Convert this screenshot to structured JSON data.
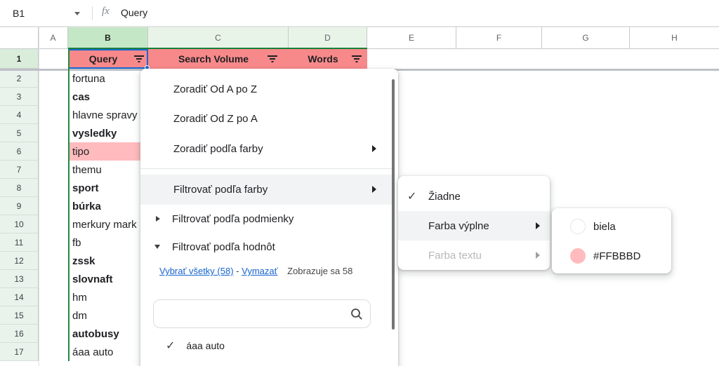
{
  "formula_bar": {
    "cell_ref": "B1",
    "fx_label": "fx",
    "value": "Query"
  },
  "sheet": {
    "col_letters": [
      "A",
      "B",
      "C",
      "D",
      "E",
      "F",
      "G",
      "H"
    ],
    "selected_column": "B",
    "header_cells": [
      {
        "col": "B",
        "label": "Query"
      },
      {
        "col": "C",
        "label": "Search Volume"
      },
      {
        "col": "D",
        "label": "Words"
      }
    ],
    "row1_number": "1",
    "rows": [
      {
        "n": "2",
        "text": "fortuna"
      },
      {
        "n": "3",
        "text": "cas"
      },
      {
        "n": "4",
        "text": "hlavne spravy"
      },
      {
        "n": "5",
        "text": "vysledky"
      },
      {
        "n": "6",
        "text": "tipo"
      },
      {
        "n": "7",
        "text": "themu"
      },
      {
        "n": "8",
        "text": "sport"
      },
      {
        "n": "9",
        "text": "búrka"
      },
      {
        "n": "10",
        "text": "merkury mark"
      },
      {
        "n": "11",
        "text": "fb"
      },
      {
        "n": "12",
        "text": "zssk"
      },
      {
        "n": "13",
        "text": "slovnaft"
      },
      {
        "n": "14",
        "text": "hm"
      },
      {
        "n": "15",
        "text": "dm"
      },
      {
        "n": "16",
        "text": "autobusy"
      },
      {
        "n": "17",
        "text": "áaa auto"
      }
    ]
  },
  "filter_menu": {
    "sort_az": "Zoradiť Od A po Z",
    "sort_za": "Zoradiť Od Z po A",
    "sort_color": "Zoradiť podľa farby",
    "filter_color": "Filtrovať podľa farby",
    "filter_condition": "Filtrovať podľa podmienky",
    "filter_values": "Filtrovať podľa hodnôt",
    "select_all": "Vybrať všetky (58)",
    "dash": "-",
    "clear": "Vymazať",
    "showing": "Zobrazuje sa 58",
    "search_placeholder": "",
    "value_item": "áaa auto"
  },
  "color_menu": {
    "none": "Žiadne",
    "fill_color": "Farba výplne",
    "text_color": "Farba textu"
  },
  "fill_menu": {
    "white_label": "biela",
    "pink_label": "#FFBBBD"
  },
  "colors": {
    "header_fill": "#F8898B",
    "highlight_fill": "#FFBBBD",
    "selection_blue": "#1967D2",
    "range_green": "#1E8E3E",
    "link_blue": "#1763CF"
  }
}
